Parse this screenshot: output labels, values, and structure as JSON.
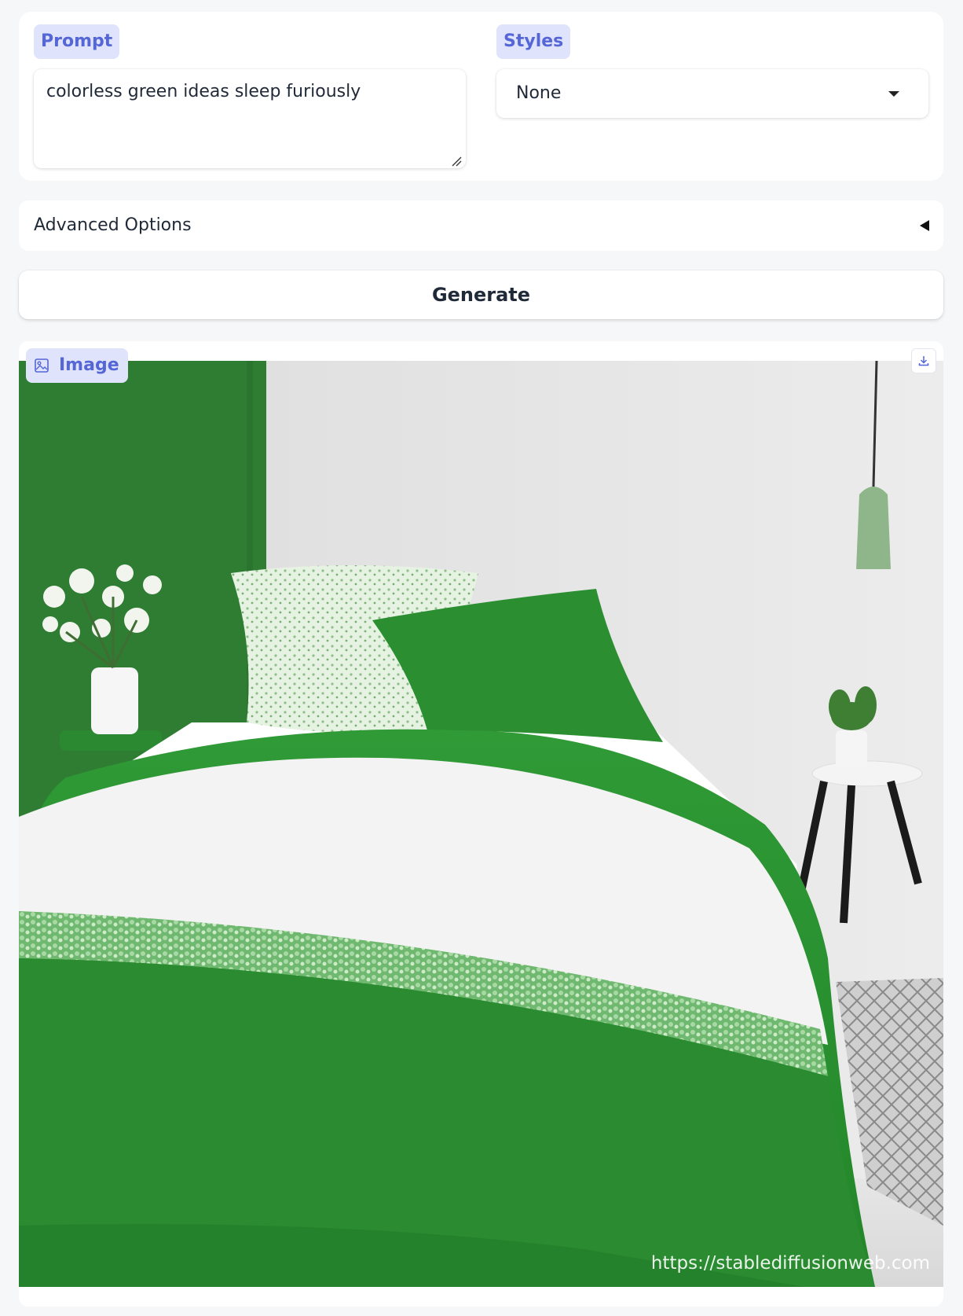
{
  "prompt": {
    "label": "Prompt",
    "value": "colorless green ideas sleep furiously"
  },
  "styles": {
    "label": "Styles",
    "selected": "None"
  },
  "advanced": {
    "label": "Advanced Options"
  },
  "generate": {
    "label": "Generate"
  },
  "output": {
    "label": "Image",
    "watermark": "https://stablediffusionweb.com",
    "description": "Generated image: bedroom with green and white bedding, green accent wall, white flowers, side table with plant, pendant lamp"
  },
  "icons": {
    "image": "image-icon",
    "download": "download-icon",
    "styles_caret": "caret-down-icon",
    "advanced_toggle": "triangle-left-icon"
  },
  "colors": {
    "chip_bg": "#dfe3fb",
    "chip_text": "#5566d6",
    "page_bg": "#f6f7f9"
  }
}
